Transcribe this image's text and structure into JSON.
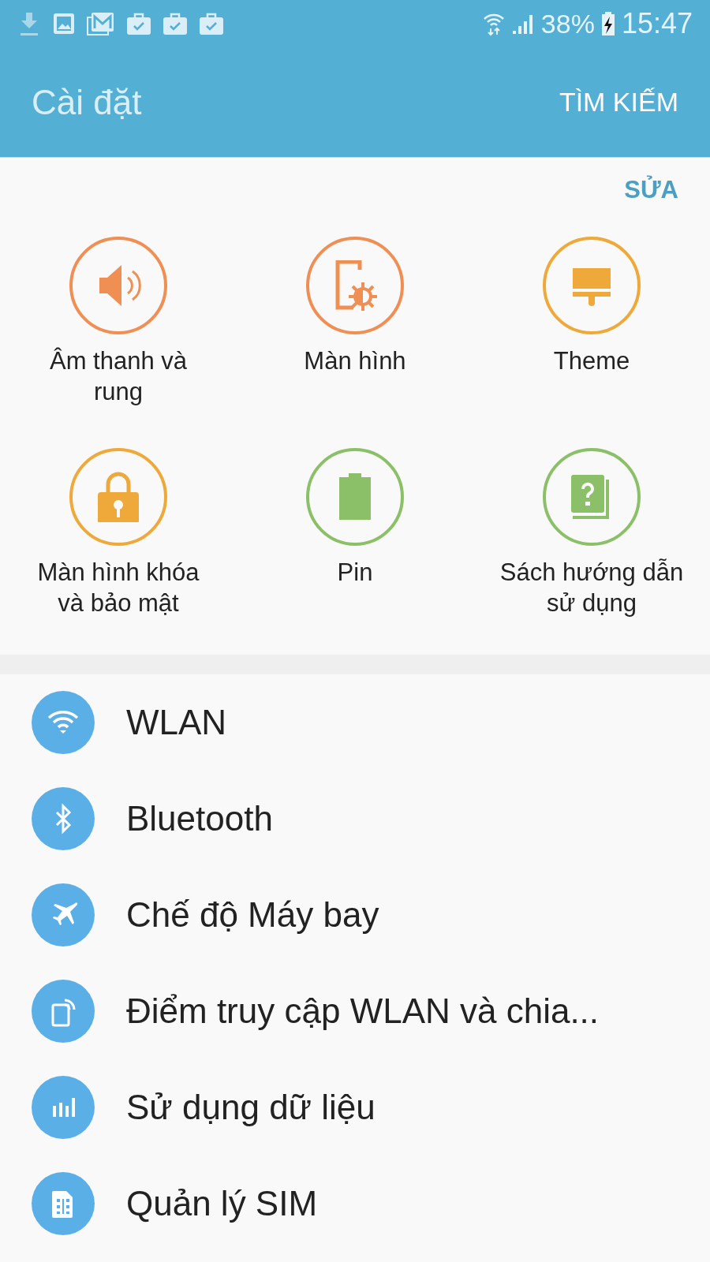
{
  "status_bar": {
    "battery": "38%",
    "time": "15:47"
  },
  "app_bar": {
    "title": "Cài đặt",
    "action": "TÌM KIẾM"
  },
  "quick_settings": {
    "edit": "SỬA",
    "tiles": [
      {
        "label": "Âm thanh và rung",
        "kind": "sound",
        "color": "#ef8f54"
      },
      {
        "label": "Màn hình",
        "kind": "display",
        "color": "#ef8f54"
      },
      {
        "label": "Theme",
        "kind": "theme",
        "color": "#eea93a"
      },
      {
        "label": "Màn hình khóa và bảo mật",
        "kind": "lock",
        "color": "#eea93a"
      },
      {
        "label": "Pin",
        "kind": "battery",
        "color": "#8bc068"
      },
      {
        "label": "Sách hướng dẫn sử dụng",
        "kind": "manual",
        "color": "#8bc068"
      }
    ]
  },
  "settings_list": [
    {
      "label": "WLAN",
      "kind": "wifi"
    },
    {
      "label": "Bluetooth",
      "kind": "bluetooth"
    },
    {
      "label": "Chế độ Máy bay",
      "kind": "airplane"
    },
    {
      "label": "Điểm truy cập WLAN và chia...",
      "kind": "hotspot"
    },
    {
      "label": "Sử dụng dữ liệu",
      "kind": "data"
    },
    {
      "label": "Quản lý SIM",
      "kind": "sim"
    }
  ]
}
